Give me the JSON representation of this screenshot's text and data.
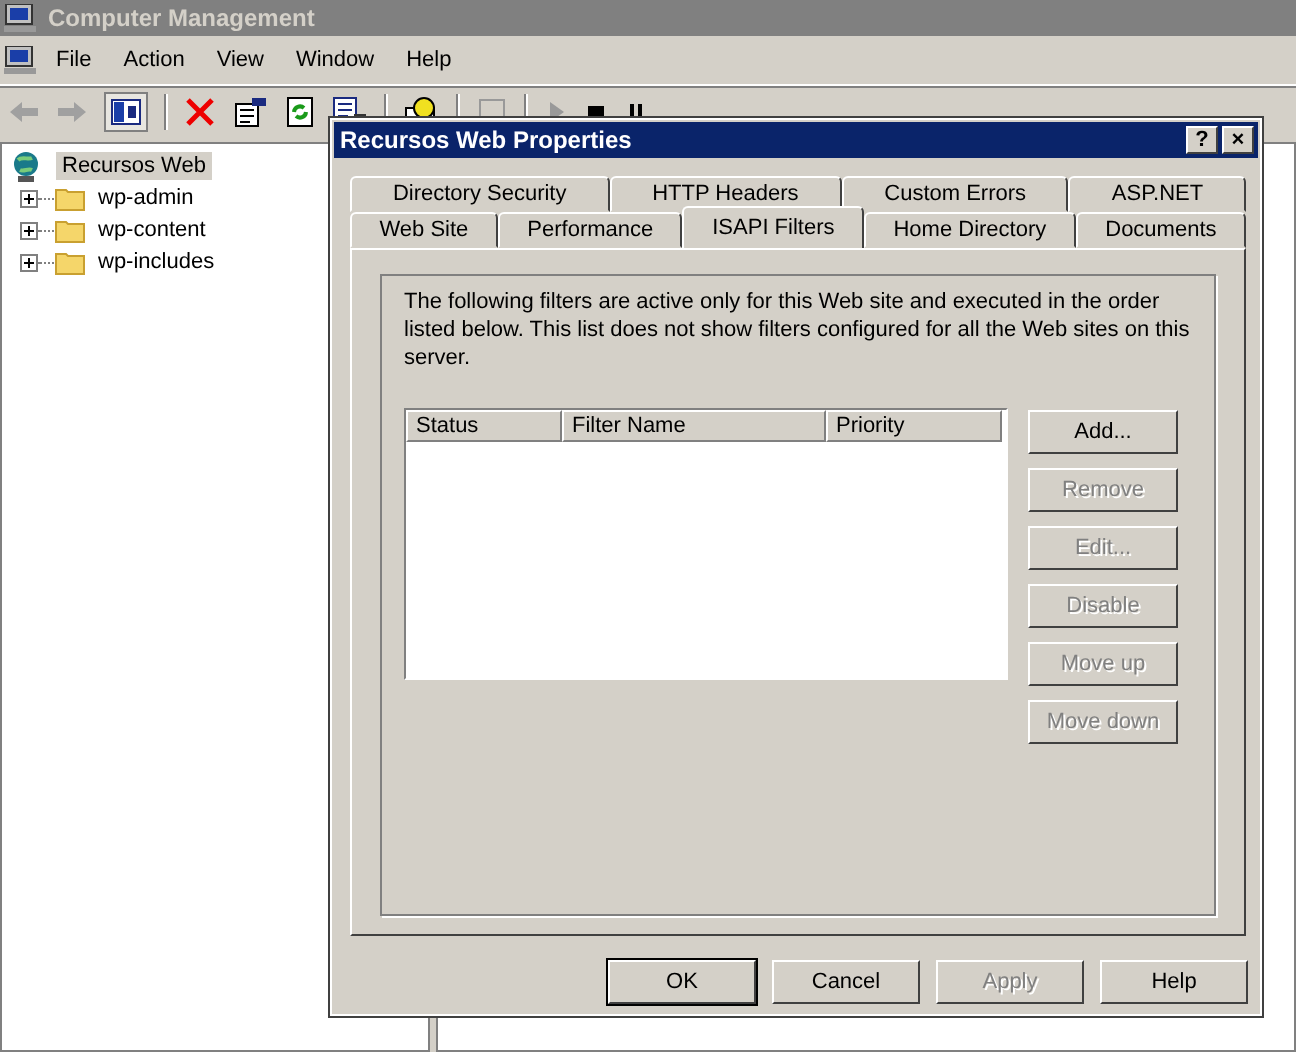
{
  "window": {
    "title": "Computer Management"
  },
  "menu": [
    "File",
    "Action",
    "View",
    "Window",
    "Help"
  ],
  "tree": {
    "label": "Recursos Web",
    "selected": true,
    "children": [
      {
        "label": "wp-admin",
        "expanded": false
      },
      {
        "label": "wp-content",
        "expanded": false
      },
      {
        "label": "wp-includes",
        "expanded": false
      }
    ]
  },
  "dialog": {
    "title": "Recursos Web Properties",
    "help_button": "?",
    "close_button": "×",
    "tab_rows": [
      [
        {
          "label": "Directory Security",
          "selected": false
        },
        {
          "label": "HTTP Headers",
          "selected": false
        },
        {
          "label": "Custom Errors",
          "selected": false
        },
        {
          "label": "ASP.NET",
          "selected": false
        }
      ],
      [
        {
          "label": "Web Site",
          "selected": false
        },
        {
          "label": "Performance",
          "selected": false
        },
        {
          "label": "ISAPI Filters",
          "selected": true
        },
        {
          "label": "Home Directory",
          "selected": false
        },
        {
          "label": "Documents",
          "selected": false
        }
      ]
    ],
    "description": "The following filters are active only for this Web site and executed in the order listed below. This list does not show filters configured for all the Web sites on this server.",
    "list_columns": [
      "Status",
      "Filter Name",
      "Priority"
    ],
    "side_buttons": [
      {
        "label": "Add...",
        "disabled": false
      },
      {
        "label": "Remove",
        "disabled": true
      },
      {
        "label": "Edit...",
        "disabled": true
      },
      {
        "label": "Disable",
        "disabled": true
      },
      {
        "label": "Move up",
        "disabled": true
      },
      {
        "label": "Move down",
        "disabled": true
      }
    ],
    "bottom_buttons": [
      {
        "label": "OK",
        "disabled": false
      },
      {
        "label": "Cancel",
        "disabled": false
      },
      {
        "label": "Apply",
        "disabled": true
      },
      {
        "label": "Help",
        "disabled": false
      }
    ]
  }
}
